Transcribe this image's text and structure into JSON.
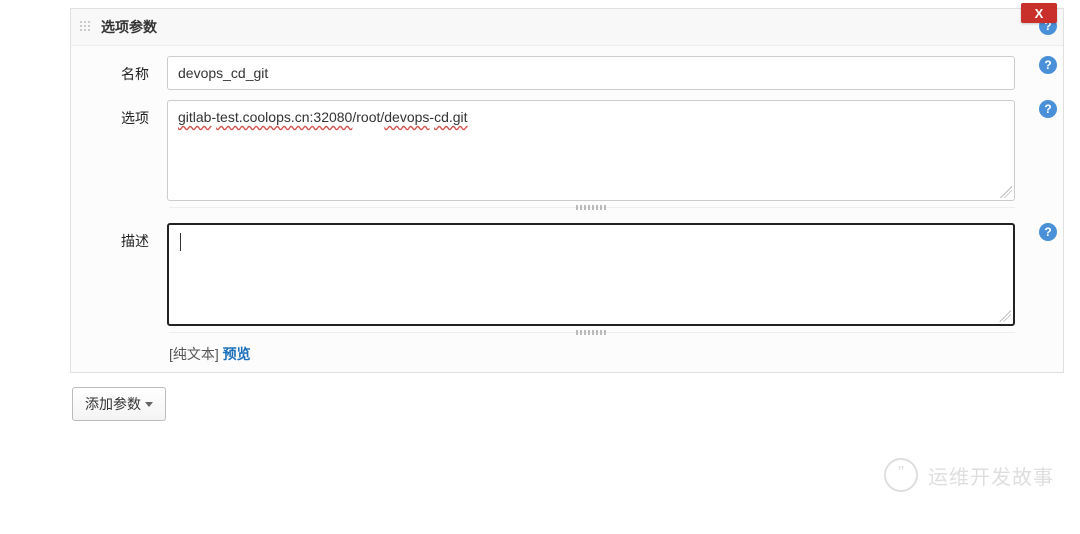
{
  "panel": {
    "title": "选项参数",
    "close_label": "X"
  },
  "labels": {
    "name": "名称",
    "options": "选项",
    "description": "描述"
  },
  "fields": {
    "name_value": "devops_cd_git",
    "options_raw": "gitlab-test.coolops.cn:32080/root/devops-cd.git",
    "options_parts": {
      "p1": "gitlab",
      "p2": "-",
      "p3": "test.coolops.cn:32080",
      "p4": "/root/",
      "p5": "devops",
      "p6": "-",
      "p7": "cd.git"
    },
    "description_value": ""
  },
  "format": {
    "plain_text": "[纯文本]",
    "preview": "预览"
  },
  "buttons": {
    "add_param": "添加参数"
  },
  "help_symbol": "?",
  "watermark": {
    "text": "运维开发故事",
    "glyph": "”"
  }
}
